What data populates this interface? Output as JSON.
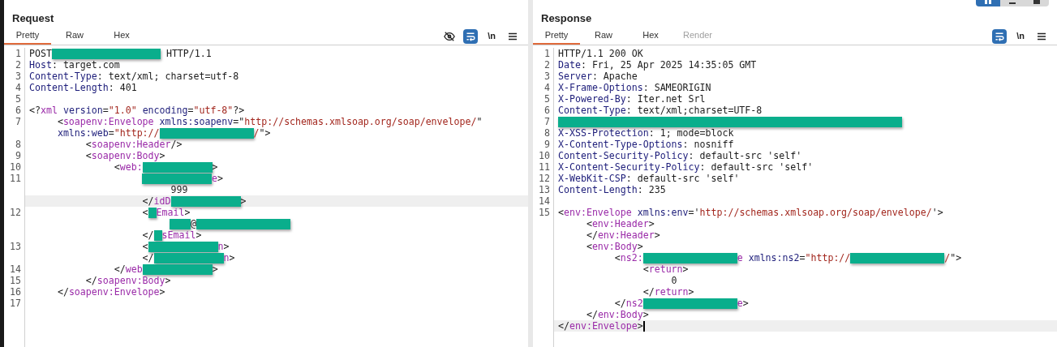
{
  "layout_buttons": [
    {
      "kind": "split",
      "selected": true
    },
    {
      "kind": "horizontal",
      "selected": false
    },
    {
      "kind": "single",
      "selected": false
    }
  ],
  "panels": [
    {
      "title": "Request",
      "tabs": [
        {
          "label": "Pretty",
          "selected": true,
          "disabled": false
        },
        {
          "label": "Raw",
          "selected": false,
          "disabled": false
        },
        {
          "label": "Hex",
          "selected": false,
          "disabled": false
        }
      ],
      "tools": [
        {
          "kind": "hide",
          "selected": false
        },
        {
          "kind": "wrap",
          "selected": true
        },
        {
          "kind": "newline",
          "label": "\\n",
          "selected": false
        },
        {
          "kind": "menu",
          "selected": false
        }
      ],
      "lines": [
        {
          "number": "1",
          "highlighted": false,
          "tokens": [
            {
              "kind": "plain",
              "text": "POST"
            },
            {
              "kind": "redacted_long"
            },
            {
              "kind": "plain",
              "text": " HTTP/1.1"
            }
          ]
        },
        {
          "number": "2",
          "highlighted": false,
          "tokens": [
            {
              "kind": "name",
              "text": "Host"
            },
            {
              "kind": "plain",
              "text": ": target.com"
            }
          ]
        },
        {
          "number": "3",
          "highlighted": false,
          "tokens": [
            {
              "kind": "name",
              "text": "Content-Type"
            },
            {
              "kind": "plain",
              "text": ": text/xml; charset=utf-8"
            }
          ]
        },
        {
          "number": "4",
          "highlighted": false,
          "tokens": [
            {
              "kind": "name",
              "text": "Content-Length"
            },
            {
              "kind": "plain",
              "text": ": 401"
            }
          ]
        },
        {
          "number": "5",
          "highlighted": false
        },
        {
          "number": "6",
          "highlighted": false,
          "tokens": [
            {
              "kind": "plain",
              "text": "<?"
            },
            {
              "kind": "tag",
              "text": "xml"
            },
            {
              "kind": "attr",
              "text": " version"
            },
            {
              "kind": "plain",
              "text": "="
            },
            {
              "kind": "str",
              "text": "\"1.0\""
            },
            {
              "kind": "attr",
              "text": " encoding"
            },
            {
              "kind": "plain",
              "text": "="
            },
            {
              "kind": "str",
              "text": "\"utf-8\""
            },
            {
              "kind": "plain",
              "text": "?>"
            }
          ]
        },
        {
          "number": "7",
          "highlighted": false,
          "tokens": [
            {
              "kind": "plain",
              "text": "     <"
            },
            {
              "kind": "tag",
              "text": "soapenv:Envelope"
            },
            {
              "kind": "attr",
              "text": " xmlns:soapenv"
            },
            {
              "kind": "plain",
              "text": "=\""
            },
            {
              "kind": "str",
              "text": "http://schemas.xmlsoap.org/soap/envelope/"
            },
            {
              "kind": "plain",
              "text": "\""
            }
          ]
        },
        {
          "highlighted": false,
          "tokens": [
            {
              "kind": "attr",
              "text": "     xmlns:web"
            },
            {
              "kind": "plain",
              "text": "="
            },
            {
              "kind": "str",
              "text": "\"http://"
            },
            {
              "kind": "redacted_large"
            },
            {
              "kind": "str",
              "text": "/"
            },
            {
              "kind": "plain",
              "text": "\">"
            }
          ]
        },
        {
          "number": "8",
          "highlighted": false,
          "tokens": [
            {
              "kind": "plain",
              "text": "          <"
            },
            {
              "kind": "tag",
              "text": "soapenv:Header"
            },
            {
              "kind": "plain",
              "text": "/>"
            }
          ]
        },
        {
          "number": "9",
          "highlighted": false,
          "tokens": [
            {
              "kind": "plain",
              "text": "          <"
            },
            {
              "kind": "tag",
              "text": "soapenv:Body"
            },
            {
              "kind": "plain",
              "text": ">"
            }
          ]
        },
        {
          "number": "10",
          "highlighted": false,
          "tokens": [
            {
              "kind": "plain",
              "text": "               <"
            },
            {
              "kind": "tag",
              "text": "web:"
            },
            {
              "kind": "redacted_medium"
            },
            {
              "kind": "plain",
              "text": ">"
            }
          ]
        },
        {
          "number": "11",
          "highlighted": false,
          "tokens": [
            {
              "kind": "indent_deep"
            },
            {
              "kind": "redacted_medium"
            },
            {
              "kind": "tag",
              "text": "e"
            },
            {
              "kind": "plain",
              "text": ">"
            }
          ]
        },
        {
          "highlighted": false,
          "tokens": [
            {
              "kind": "plain",
              "text": "                         999"
            }
          ]
        },
        {
          "highlighted": true,
          "tokens": [
            {
              "kind": "plain",
              "text": "                    </"
            },
            {
              "kind": "tag",
              "text": "idD"
            },
            {
              "kind": "redacted_medium"
            },
            {
              "kind": "plain",
              "text": ">"
            }
          ]
        },
        {
          "number": "12",
          "highlighted": false,
          "tokens": [
            {
              "kind": "plain",
              "text": "                    <"
            },
            {
              "kind": "redacted_tiny"
            },
            {
              "kind": "tag",
              "text": "Email"
            },
            {
              "kind": "plain",
              "text": ">"
            }
          ]
        },
        {
          "highlighted": false,
          "tokens": [
            {
              "kind": "indent_deeper"
            },
            {
              "kind": "redacted_small"
            },
            {
              "kind": "plain",
              "text": "@"
            },
            {
              "kind": "redacted_large"
            }
          ]
        },
        {
          "highlighted": false,
          "tokens": [
            {
              "kind": "plain",
              "text": "                    </"
            },
            {
              "kind": "redacted_tiny"
            },
            {
              "kind": "tag",
              "text": "sEmail"
            },
            {
              "kind": "plain",
              "text": ">"
            }
          ]
        },
        {
          "number": "13",
          "highlighted": false,
          "tokens": [
            {
              "kind": "plain",
              "text": "                    <"
            },
            {
              "kind": "redacted_medium"
            },
            {
              "kind": "tag",
              "text": "n"
            },
            {
              "kind": "plain",
              "text": ">"
            }
          ]
        },
        {
          "highlighted": false,
          "tokens": [
            {
              "kind": "plain",
              "text": "                    </"
            },
            {
              "kind": "redacted_medium"
            },
            {
              "kind": "tag",
              "text": "n"
            },
            {
              "kind": "plain",
              "text": ">"
            }
          ]
        },
        {
          "number": "14",
          "highlighted": false,
          "tokens": [
            {
              "kind": "plain",
              "text": "               </"
            },
            {
              "kind": "tag",
              "text": "web"
            },
            {
              "kind": "redacted_medium"
            },
            {
              "kind": "plain",
              "text": ">"
            }
          ]
        },
        {
          "number": "15",
          "highlighted": false,
          "tokens": [
            {
              "kind": "plain",
              "text": "          </"
            },
            {
              "kind": "tag",
              "text": "soapenv:Body"
            },
            {
              "kind": "plain",
              "text": ">"
            }
          ]
        },
        {
          "number": "16",
          "highlighted": false,
          "tokens": [
            {
              "kind": "plain",
              "text": "     </"
            },
            {
              "kind": "tag",
              "text": "soapenv:Envelope"
            },
            {
              "kind": "plain",
              "text": ">"
            }
          ]
        },
        {
          "number": "17",
          "highlighted": false
        }
      ]
    },
    {
      "title": "Response",
      "tabs": [
        {
          "label": "Pretty",
          "selected": true,
          "disabled": false
        },
        {
          "label": "Raw",
          "selected": false,
          "disabled": false
        },
        {
          "label": "Hex",
          "selected": false,
          "disabled": false
        },
        {
          "label": "Render",
          "selected": false,
          "disabled": true
        }
      ],
      "tools": [
        {
          "kind": "wrap",
          "selected": true
        },
        {
          "kind": "newline",
          "label": "\\n",
          "selected": false
        },
        {
          "kind": "menu",
          "selected": false
        }
      ],
      "lines": [
        {
          "number": "1",
          "highlighted": false,
          "tokens": [
            {
              "kind": "plain",
              "text": "HTTP/1.1 200 OK"
            }
          ]
        },
        {
          "number": "2",
          "highlighted": false,
          "tokens": [
            {
              "kind": "name",
              "text": "Date"
            },
            {
              "kind": "plain",
              "text": ": Fri, 25 Apr 2025 14:35:05 GMT"
            }
          ]
        },
        {
          "number": "3",
          "highlighted": false,
          "tokens": [
            {
              "kind": "name",
              "text": "Server"
            },
            {
              "kind": "plain",
              "text": ": Apache"
            }
          ]
        },
        {
          "number": "4",
          "highlighted": false,
          "tokens": [
            {
              "kind": "name",
              "text": "X-Frame-Options"
            },
            {
              "kind": "plain",
              "text": ": SAMEORIGIN"
            }
          ]
        },
        {
          "number": "5",
          "highlighted": false,
          "tokens": [
            {
              "kind": "name",
              "text": "X-Powered-By"
            },
            {
              "kind": "plain",
              "text": ": Iter.net Srl"
            }
          ]
        },
        {
          "number": "6",
          "highlighted": false,
          "tokens": [
            {
              "kind": "name",
              "text": "Content-Type"
            },
            {
              "kind": "plain",
              "text": ": text/xml;charset=UTF-8"
            }
          ]
        },
        {
          "number": "7",
          "highlighted": false,
          "tokens": [
            {
              "kind": "redacted_full"
            }
          ]
        },
        {
          "number": "8",
          "highlighted": false,
          "tokens": [
            {
              "kind": "name",
              "text": "X-XSS-Protection"
            },
            {
              "kind": "plain",
              "text": ": 1; mode=block"
            }
          ]
        },
        {
          "number": "9",
          "highlighted": false,
          "tokens": [
            {
              "kind": "name",
              "text": "X-Content-Type-Options"
            },
            {
              "kind": "plain",
              "text": ": nosniff"
            }
          ]
        },
        {
          "number": "10",
          "highlighted": false,
          "tokens": [
            {
              "kind": "name",
              "text": "Content-Security-Policy"
            },
            {
              "kind": "plain",
              "text": ": default-src 'self'"
            }
          ]
        },
        {
          "number": "11",
          "highlighted": false,
          "tokens": [
            {
              "kind": "name",
              "text": "X-Content-Security-Policy"
            },
            {
              "kind": "plain",
              "text": ": default-src 'self'"
            }
          ]
        },
        {
          "number": "12",
          "highlighted": false,
          "tokens": [
            {
              "kind": "name",
              "text": "X-WebKit-CSP"
            },
            {
              "kind": "plain",
              "text": ": default-src 'self'"
            }
          ]
        },
        {
          "number": "13",
          "highlighted": false,
          "tokens": [
            {
              "kind": "name",
              "text": "Content-Length"
            },
            {
              "kind": "plain",
              "text": ": 235"
            }
          ]
        },
        {
          "number": "14",
          "highlighted": false
        },
        {
          "number": "15",
          "highlighted": false,
          "tokens": [
            {
              "kind": "plain",
              "text": "<"
            },
            {
              "kind": "tag",
              "text": "env:Envelope"
            },
            {
              "kind": "attr",
              "text": " xmlns:env"
            },
            {
              "kind": "plain",
              "text": "='"
            },
            {
              "kind": "str",
              "text": "http://schemas.xmlsoap.org/soap/envelope/"
            },
            {
              "kind": "plain",
              "text": "'>"
            }
          ]
        },
        {
          "highlighted": false,
          "tokens": [
            {
              "kind": "plain",
              "text": "     <"
            },
            {
              "kind": "tag",
              "text": "env:Header"
            },
            {
              "kind": "plain",
              "text": ">"
            }
          ]
        },
        {
          "highlighted": false,
          "tokens": [
            {
              "kind": "plain",
              "text": "     </"
            },
            {
              "kind": "tag",
              "text": "env:Header"
            },
            {
              "kind": "plain",
              "text": ">"
            }
          ]
        },
        {
          "highlighted": false,
          "tokens": [
            {
              "kind": "plain",
              "text": "     <"
            },
            {
              "kind": "tag",
              "text": "env:Body"
            },
            {
              "kind": "plain",
              "text": ">"
            }
          ]
        },
        {
          "highlighted": false,
          "tokens": [
            {
              "kind": "plain",
              "text": "          <"
            },
            {
              "kind": "tag",
              "text": "ns2:"
            },
            {
              "kind": "redacted_large"
            },
            {
              "kind": "tag",
              "text": "e"
            },
            {
              "kind": "attr",
              "text": " xmlns:ns2"
            },
            {
              "kind": "plain",
              "text": "="
            },
            {
              "kind": "str",
              "text": "\"http://"
            },
            {
              "kind": "redacted_large"
            },
            {
              "kind": "str",
              "text": "/"
            },
            {
              "kind": "plain",
              "text": "\">"
            }
          ]
        },
        {
          "highlighted": false,
          "tokens": [
            {
              "kind": "plain",
              "text": "               <"
            },
            {
              "kind": "tag",
              "text": "return"
            },
            {
              "kind": "plain",
              "text": ">"
            }
          ]
        },
        {
          "highlighted": false,
          "tokens": [
            {
              "kind": "plain",
              "text": "                    0"
            }
          ]
        },
        {
          "highlighted": false,
          "tokens": [
            {
              "kind": "plain",
              "text": "               </"
            },
            {
              "kind": "tag",
              "text": "return"
            },
            {
              "kind": "plain",
              "text": ">"
            }
          ]
        },
        {
          "highlighted": false,
          "tokens": [
            {
              "kind": "plain",
              "text": "          </"
            },
            {
              "kind": "tag",
              "text": "ns2"
            },
            {
              "kind": "redacted_large"
            },
            {
              "kind": "tag",
              "text": "e"
            },
            {
              "kind": "plain",
              "text": ">"
            }
          ]
        },
        {
          "highlighted": false,
          "tokens": [
            {
              "kind": "plain",
              "text": "     </"
            },
            {
              "kind": "tag",
              "text": "env:Body"
            },
            {
              "kind": "plain",
              "text": ">"
            }
          ]
        },
        {
          "highlighted": true,
          "cursor": true,
          "tokens": [
            {
              "kind": "plain",
              "text": "</"
            },
            {
              "kind": "tag",
              "text": "env:Envelope"
            },
            {
              "kind": "plain",
              "text": ">"
            }
          ]
        }
      ]
    }
  ]
}
